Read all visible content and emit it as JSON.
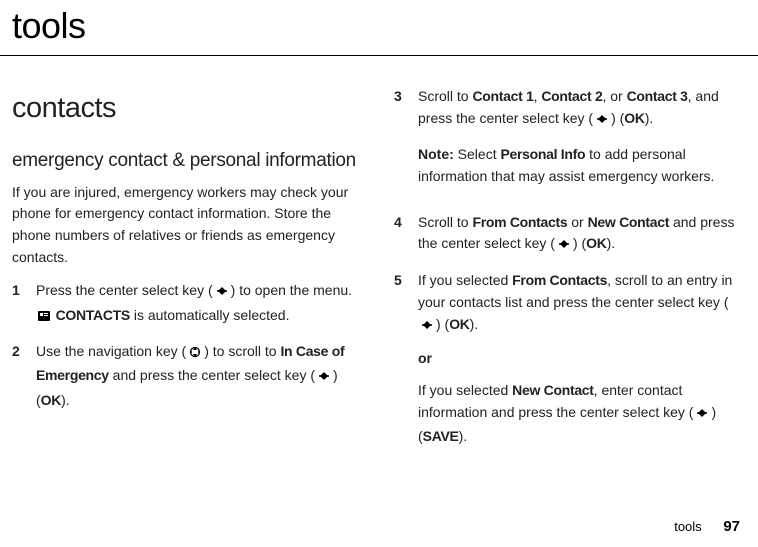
{
  "pageTitle": "tools",
  "leftCol": {
    "sectionHeading": "contacts",
    "subHeading": "emergency contact & personal information",
    "intro": "If you are injured, emergency workers may check your phone for emergency contact information. Store the phone numbers of relatives or friends as emergency contacts.",
    "step1": {
      "num": "1",
      "a": "Press the center select key (",
      "b": ") to open the menu. ",
      "c": " CONTACTS",
      "d": " is automatically selected."
    },
    "step2": {
      "num": "2",
      "a": "Use the navigation key (",
      "b": ") to scroll to ",
      "c": "In Case of Emergency",
      "d": " and press the center select key (",
      "e": ") (",
      "ok": "OK",
      "f": ")."
    }
  },
  "rightCol": {
    "step3": {
      "num": "3",
      "a": "Scroll to ",
      "c1": "Contact 1",
      "sep1": ", ",
      "c2": "Contact 2",
      "sep2": ", or ",
      "c3": "Contact 3",
      "b": ", and press the center select key (",
      "c": ") (",
      "ok": "OK",
      "d": ").",
      "noteLabel": "Note:",
      "noteA": " Select ",
      "noteB": "Personal Info",
      "noteC": " to add personal information that may assist emergency workers."
    },
    "step4": {
      "num": "4",
      "a": "Scroll to ",
      "fc": "From Contacts",
      "or": " or ",
      "nc": "New Contact",
      "b": " and press the center select key (",
      "c": ") (",
      "ok": "OK",
      "d": ")."
    },
    "step5": {
      "num": "5",
      "a": "If you selected ",
      "fc": "From Contacts",
      "b": ", scroll to an entry in your contacts list and press the center select key (",
      "c": ") (",
      "ok": "OK",
      "d": ").",
      "or": "or",
      "e": "If you selected ",
      "nc": "New Contact",
      "f": ", enter contact information and press the center select key (",
      "g": ") (",
      "save": "SAVE",
      "h": ")."
    }
  },
  "footer": {
    "label": "tools",
    "page": "97"
  }
}
